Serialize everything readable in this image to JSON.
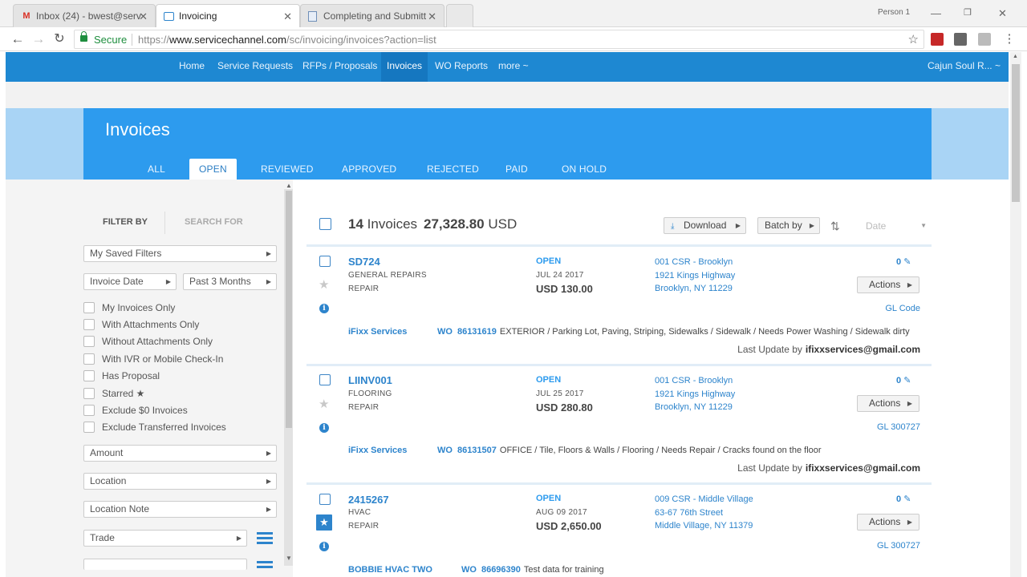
{
  "browser": {
    "tabs": [
      {
        "label": "Inbox (24) - bwest@serv",
        "icon": "gmail-icon"
      },
      {
        "label": "Invoicing",
        "icon": "servicechannel-icon"
      },
      {
        "label": "Completing and Submitt",
        "icon": "document-icon"
      }
    ],
    "profile": "Person 1",
    "secure_label": "Secure",
    "url_scheme": "https://",
    "url_host": "www.servicechannel.com",
    "url_path": "/sc/invoicing/invoices?action=list"
  },
  "nav": {
    "items": [
      "Home",
      "Service Requests",
      "RFPs / Proposals",
      "Invoices",
      "WO Reports",
      "more ~"
    ],
    "active": "Invoices",
    "user": "Cajun Soul R... ~"
  },
  "header": {
    "title": "Invoices",
    "tabs": [
      "ALL",
      "OPEN",
      "REVIEWED",
      "APPROVED",
      "REJECTED",
      "PAID",
      "ON HOLD"
    ],
    "active_tab": "OPEN"
  },
  "filters": {
    "filter_by": "FILTER BY",
    "search_for": "SEARCH FOR",
    "saved_filters": "My Saved Filters",
    "date_field": "Invoice Date",
    "date_range": "Past 3 Months",
    "checkboxes": [
      "My Invoices Only",
      "With Attachments Only",
      "Without Attachments Only",
      "With IVR or Mobile Check-In",
      "Has Proposal",
      "Starred ★",
      "Exclude $0 Invoices",
      "Exclude Transferred Invoices"
    ],
    "dropdowns": [
      "Amount",
      "Location",
      "Location Note",
      "Trade"
    ]
  },
  "summary": {
    "count": "14",
    "count_label": "Invoices",
    "total": "27,328.80",
    "currency": "USD",
    "download_label": "Download",
    "batch_label": "Batch by",
    "sort_placeholder": "Date"
  },
  "invoices": [
    {
      "number": "SD724",
      "trade": "GENERAL REPAIRS",
      "category": "REPAIR",
      "status": "OPEN",
      "date": "JUL 24 2017",
      "amount": "USD 130.00",
      "location": "001 CSR - Brooklyn",
      "address": "1921 Kings Highway",
      "city": "Brooklyn, NY 11229",
      "attachments": "0",
      "actions": "Actions",
      "gl": "GL Code",
      "provider": "iFixx Services",
      "wo_label": "WO",
      "wo_number": "86131619",
      "wo_desc": "EXTERIOR / Parking Lot, Paving, Striping, Sidewalks / Sidewalk / Needs Power Washing / Sidewalk dirty",
      "last_update_label": "Last Update by",
      "last_update_by": "ifixxservices@gmail.com",
      "starred": false
    },
    {
      "number": "LIINV001",
      "trade": "FLOORING",
      "category": "REPAIR",
      "status": "OPEN",
      "date": "JUL 25 2017",
      "amount": "USD 280.80",
      "location": "001 CSR - Brooklyn",
      "address": "1921 Kings Highway",
      "city": "Brooklyn, NY 11229",
      "attachments": "0",
      "actions": "Actions",
      "gl": "GL 300727",
      "provider": "iFixx Services",
      "wo_label": "WO",
      "wo_number": "86131507",
      "wo_desc": "OFFICE / Tile, Floors & Walls / Flooring / Needs Repair / Cracks found on the floor",
      "last_update_label": "Last Update by",
      "last_update_by": "ifixxservices@gmail.com",
      "starred": false
    },
    {
      "number": "2415267",
      "trade": "HVAC",
      "category": "REPAIR",
      "status": "OPEN",
      "date": "AUG 09 2017",
      "amount": "USD 2,650.00",
      "location": "009 CSR - Middle Village",
      "address": "63-67 76th Street",
      "city": "Middle Village, NY 11379",
      "attachments": "0",
      "actions": "Actions",
      "gl": "GL 300727",
      "provider": "BOBBIE HVAC TWO",
      "wo_label": "WO",
      "wo_number": "86696390",
      "wo_desc": "Test data for training",
      "starred": true
    }
  ]
}
